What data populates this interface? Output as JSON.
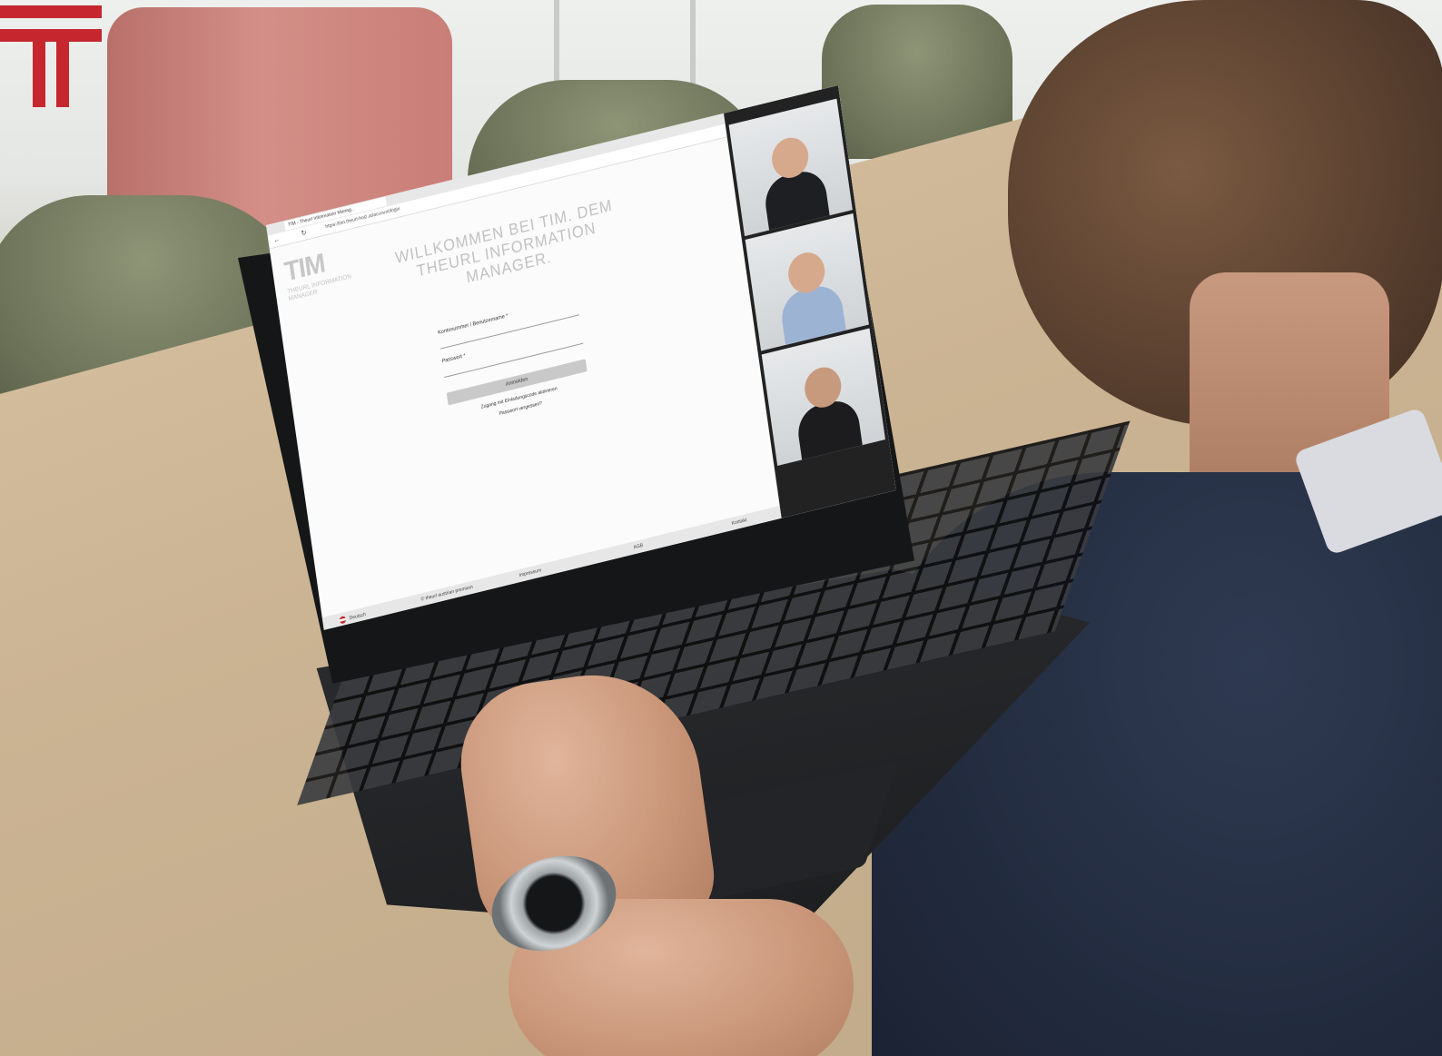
{
  "logo": {
    "color": "#c6272e"
  },
  "browser": {
    "tab_title": "TIM - Theurl Information Manag...",
    "url": "https://tim.theurl-holz.at/account/login",
    "back_icon": "arrow-left-icon",
    "refresh_icon": "refresh-icon"
  },
  "page": {
    "logo_text": "TIM",
    "logo_subtitle": "THEURL INFORMATION MANAGER",
    "welcome": "WILLKOMMEN BEI TIM. DEM THEURL INFORMATION MANAGER.",
    "username_label": "Kontonummer / Benutzername *",
    "password_label": "Passwort *",
    "login_button": "Anmelden",
    "activate_link": "Zugang mit Einladungscode aktivieren",
    "forgot_link": "Passwort vergessen?"
  },
  "footer": {
    "language": "Deutsch",
    "copyright": "© theurl austrian premium",
    "impressum": "Impressum",
    "agb": "AGB",
    "kontakt": "Kontakt"
  },
  "colors": {
    "accent": "#c6272e"
  }
}
